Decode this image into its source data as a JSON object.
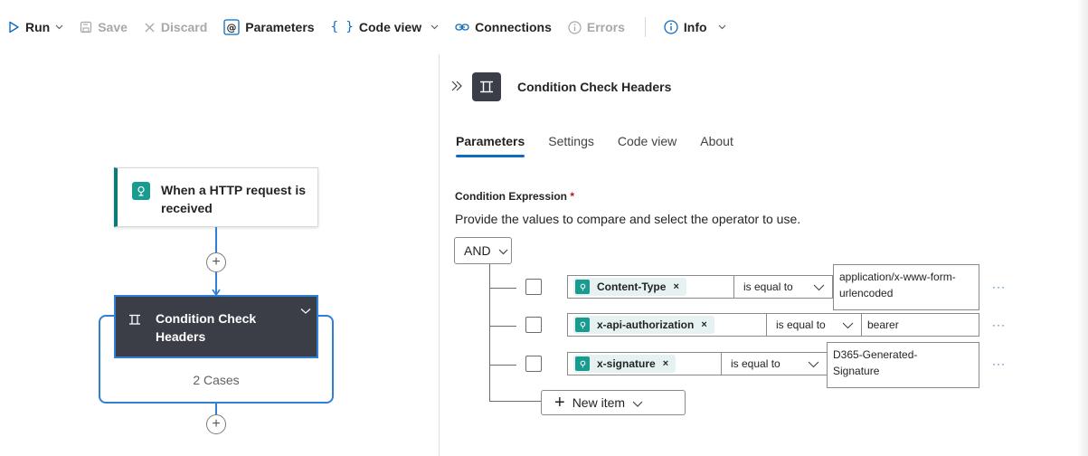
{
  "toolbar": {
    "run": "Run",
    "save": "Save",
    "discard": "Discard",
    "parameters": "Parameters",
    "code_view": "Code view",
    "connections": "Connections",
    "errors": "Errors",
    "info": "Info"
  },
  "canvas": {
    "trigger_title": "When a HTTP request is received",
    "condition_title": "Condition Check Headers",
    "cases_label": "2 Cases"
  },
  "panel": {
    "title": "Condition Check Headers",
    "tabs": [
      {
        "label": "Parameters",
        "active": true
      },
      {
        "label": "Settings",
        "active": false
      },
      {
        "label": "Code view",
        "active": false
      },
      {
        "label": "About",
        "active": false
      }
    ],
    "field_label": "Condition Expression",
    "required_mark": "*",
    "description": "Provide the values to compare and select the operator to use.",
    "group_operator": "AND",
    "rows": [
      {
        "token": "Content-Type",
        "operator": "is equal to",
        "value": "application/x-www-form-urlencoded"
      },
      {
        "token": "x-api-authorization",
        "operator": "is equal to",
        "value": "bearer"
      },
      {
        "token": "x-signature",
        "operator": "is equal to",
        "value": "D365-Generated-Signature"
      }
    ],
    "more_label": "···",
    "token_remove": "×",
    "new_item_label": "New item",
    "plus_glyph": "+"
  },
  "colors": {
    "accent": "#0f6cbd",
    "flow_line": "#2f7fd6",
    "trigger_teal": "#0f7b76",
    "condition_card": "#3b3e47",
    "required_red": "#c50f1f"
  },
  "icons": {
    "run": "play-icon",
    "save": "save-icon",
    "discard": "close-icon",
    "parameters": "at-sign-icon",
    "code_view": "braces-icon",
    "connections": "link-icon",
    "errors": "info-circle-icon",
    "info": "info-circle-icon",
    "trigger": "http-request-icon",
    "condition": "condition-icon"
  }
}
